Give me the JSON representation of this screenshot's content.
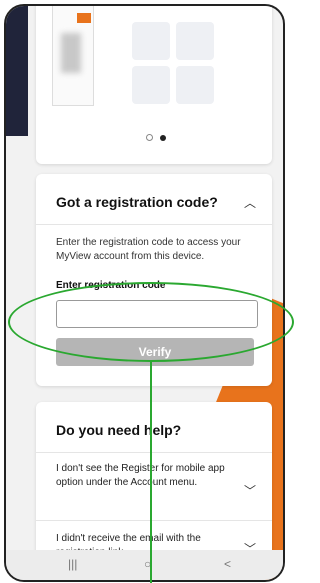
{
  "illustration": {
    "carousel_dots": 2,
    "active_dot": 2
  },
  "registration": {
    "title": "Got a registration code?",
    "description": "Enter the registration code to access your MyView account from this device.",
    "field_label": "Enter registration code",
    "field_value": "",
    "verify_label": "Verify"
  },
  "help": {
    "title": "Do you need help?",
    "items": [
      {
        "text": "I don't see the Register for mobile app option under the Account menu."
      },
      {
        "text": "I didn't receive the email with the registration link."
      }
    ]
  },
  "android_nav": {
    "recent": "|||",
    "home": "○",
    "back": "<"
  },
  "colors": {
    "accent": "#e8731c",
    "navy": "#20243a",
    "annotation": "#2aa830",
    "button_disabled": "#b5b5b5"
  },
  "icons": {
    "expanded": "chevron-up-icon",
    "collapsed": "chevron-down-icon"
  }
}
